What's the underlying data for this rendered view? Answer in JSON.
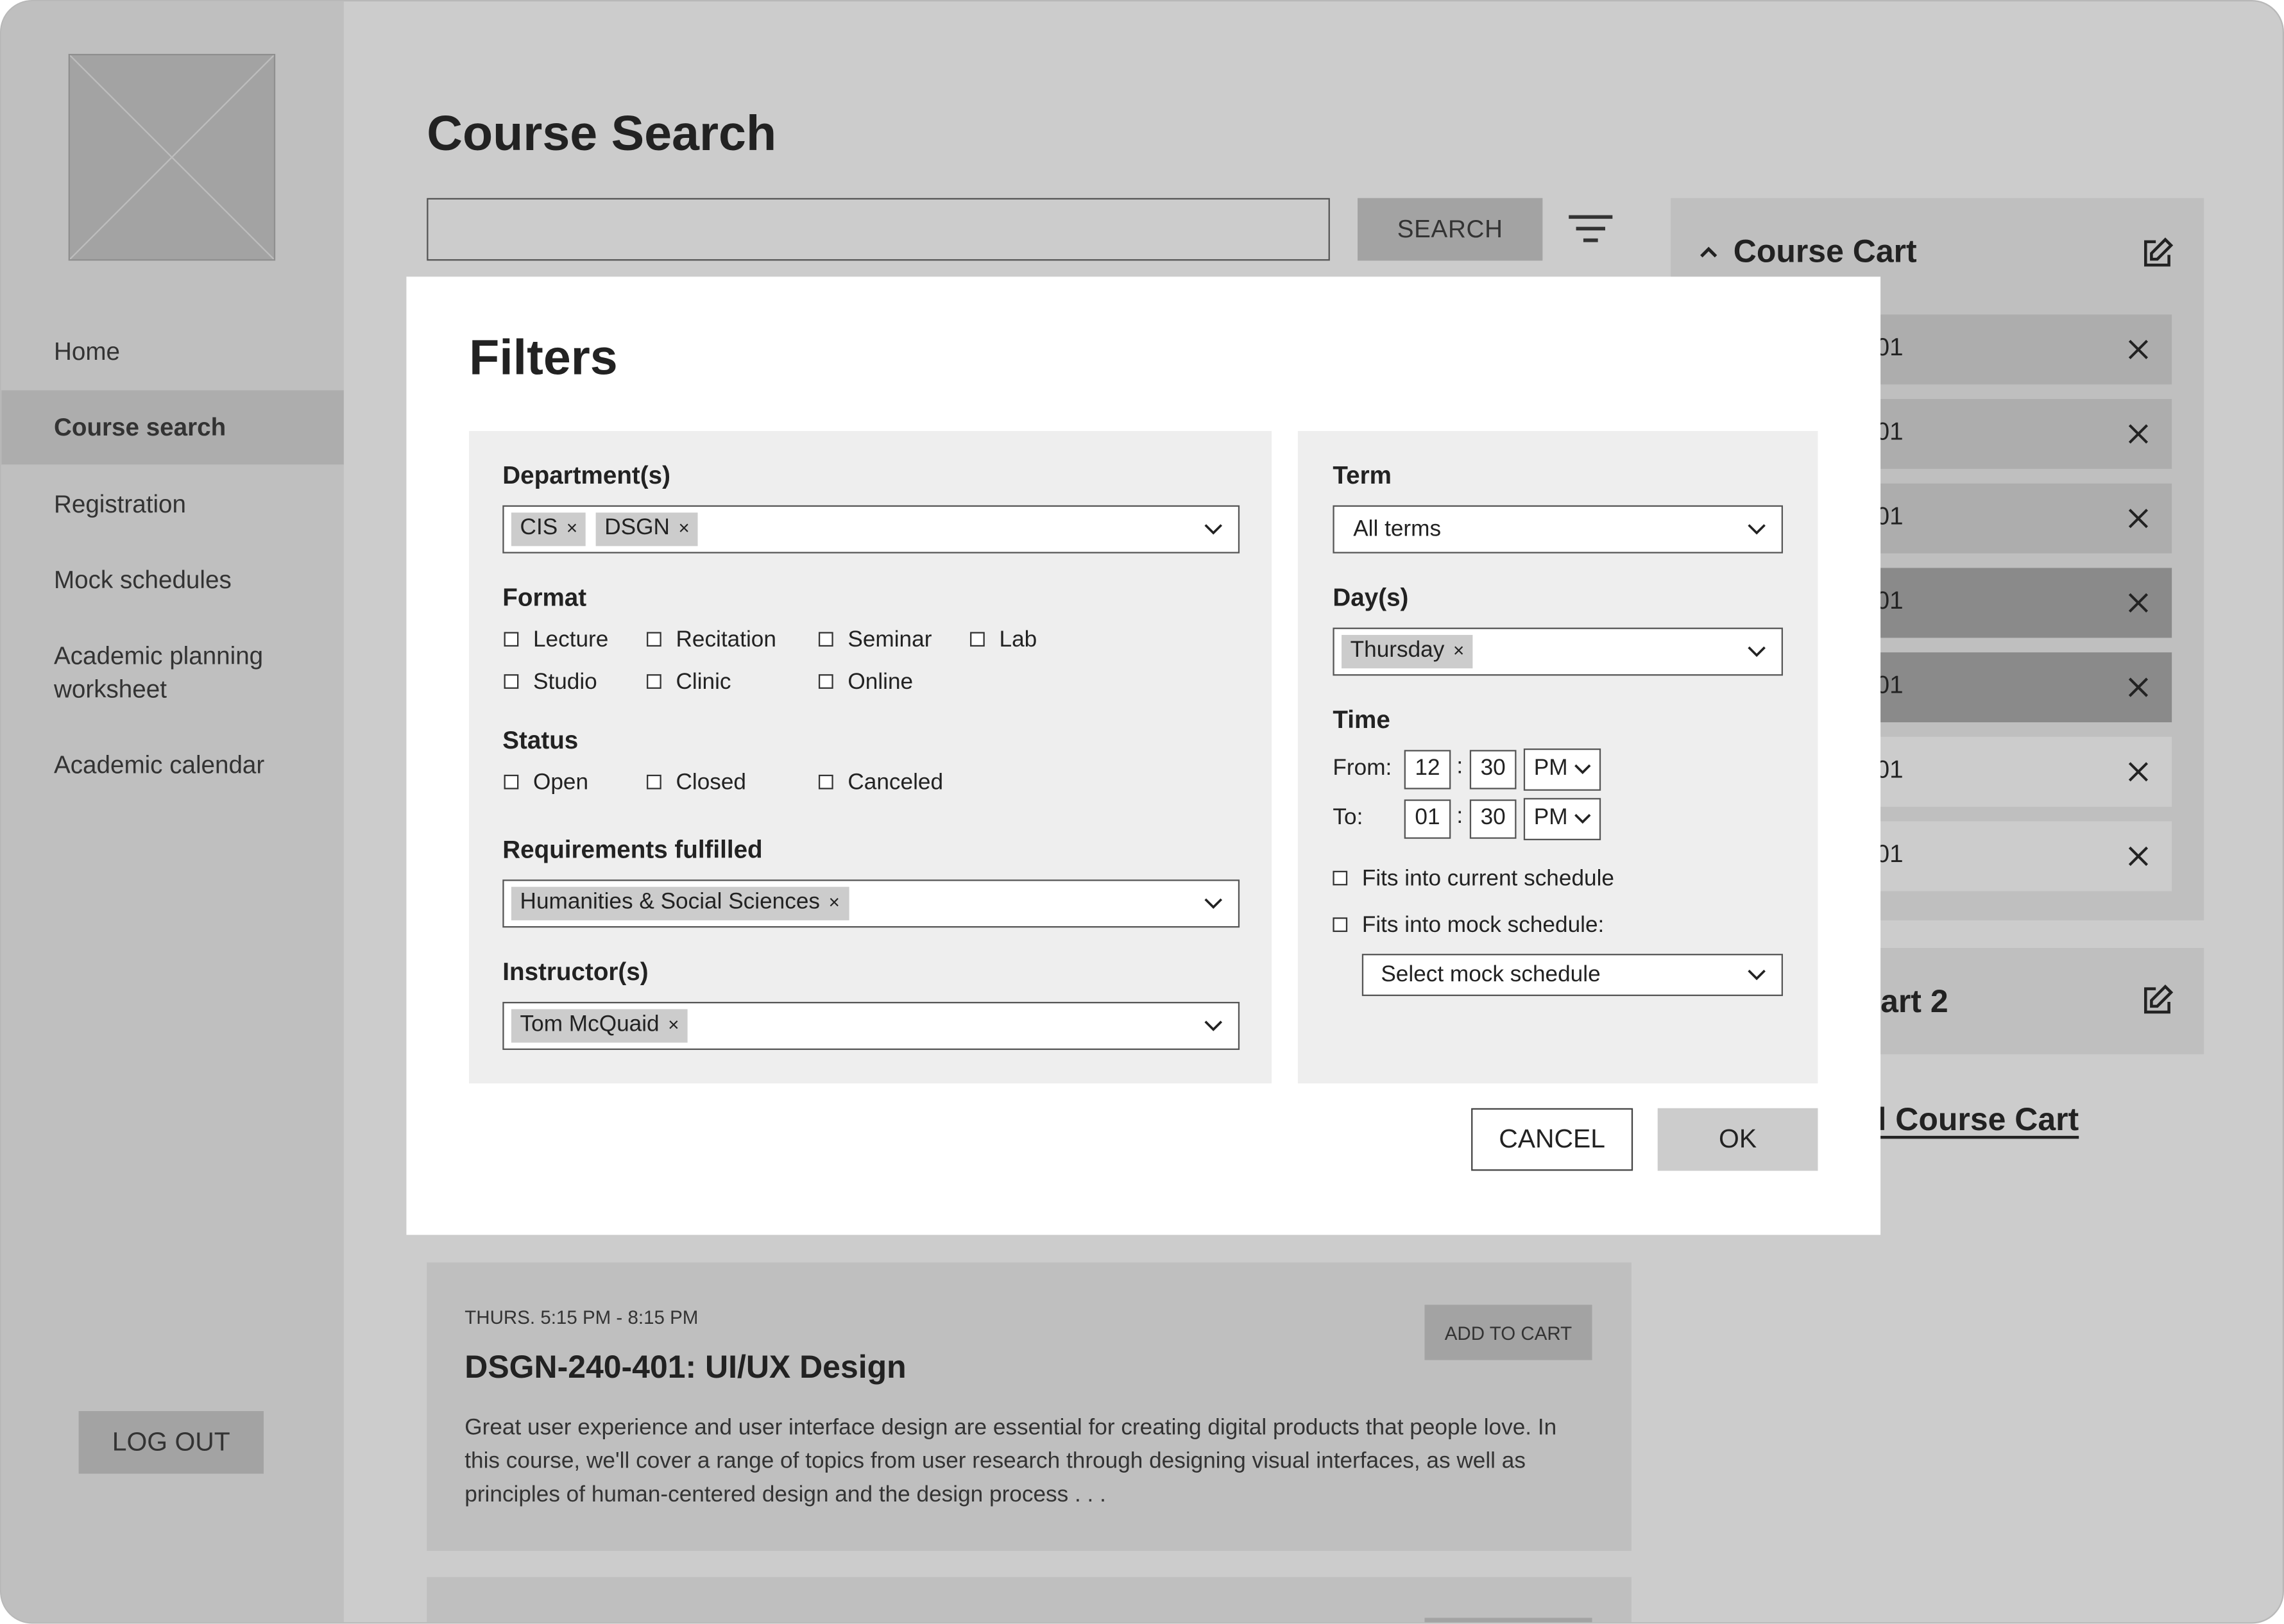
{
  "sidebar": {
    "items": [
      {
        "label": "Home"
      },
      {
        "label": "Course search"
      },
      {
        "label": "Registration"
      },
      {
        "label": "Mock schedules"
      },
      {
        "label": "Academic planning worksheet"
      },
      {
        "label": "Academic calendar"
      }
    ],
    "active_item": "Course search",
    "logout_label": "LOG OUT"
  },
  "main": {
    "title": "Course Search",
    "search_value": "",
    "search_button_label": "SEARCH"
  },
  "course_cart": {
    "title": "Course Cart",
    "items": [
      {
        "code": ".01"
      },
      {
        "code": ".01"
      },
      {
        "code": ".01"
      },
      {
        "code": ".01"
      },
      {
        "code": ".01"
      },
      {
        "code": ".01"
      },
      {
        "code": ".01"
      }
    ],
    "cart2_title": "art 2",
    "add_cart_link": "l Course Cart"
  },
  "results": [
    {
      "time": "THURS. 5:15 PM - 8:15 PM",
      "title": "DSGN-240-401: UI/UX Design",
      "description": "Great user experience and user interface design are essential for creating digital products that people love. In this course, we'll cover a range of topics from user research through designing visual interfaces, as well as principles of human-centered design and the design process . . .",
      "add_label": "ADD TO CART"
    }
  ],
  "filters": {
    "title": "Filters",
    "departments": {
      "label": "Department(s)",
      "chips": [
        "CIS",
        "DSGN"
      ]
    },
    "format": {
      "label": "Format",
      "options": [
        "Lecture",
        "Recitation",
        "Seminar",
        "Lab",
        "Studio",
        "Clinic",
        "Online"
      ]
    },
    "status": {
      "label": "Status",
      "options": [
        "Open",
        "Closed",
        "Canceled"
      ]
    },
    "requirements": {
      "label": "Requirements fulfilled",
      "chips": [
        "Humanities & Social Sciences"
      ]
    },
    "instructors": {
      "label": "Instructor(s)",
      "chips": [
        "Tom McQuaid"
      ]
    },
    "term": {
      "label": "Term",
      "value": "All terms"
    },
    "days": {
      "label": "Day(s)",
      "chips": [
        "Thursday"
      ]
    },
    "time": {
      "label": "Time",
      "from_label": "From:",
      "to_label": "To:",
      "from": {
        "hour": "12",
        "minute": "30",
        "ampm": "PM"
      },
      "to": {
        "hour": "01",
        "minute": "30",
        "ampm": "PM"
      },
      "separator": ":"
    },
    "fits_current": "Fits into current schedule",
    "fits_mock": "Fits into mock schedule:",
    "mock_select_placeholder": "Select mock schedule",
    "cancel_label": "CANCEL",
    "ok_label": "OK",
    "chip_remove_glyph": "×"
  }
}
